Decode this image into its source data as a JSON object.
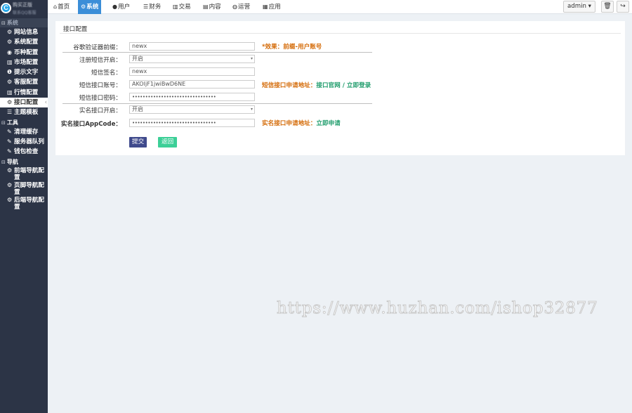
{
  "brand": {
    "logo": "C",
    "name": "购买正版",
    "sub": "联系QQ客服"
  },
  "sidebar": {
    "sections": [
      {
        "label": "系统",
        "items": [
          {
            "icon": "gear-icon",
            "glyph": "⚙",
            "label": "网站信息"
          },
          {
            "icon": "gear-icon",
            "glyph": "⚙",
            "label": "系统配置"
          },
          {
            "icon": "coin-icon",
            "glyph": "◉",
            "label": "币种配置"
          },
          {
            "icon": "bar-chart-icon",
            "glyph": "▥",
            "label": "市场配置"
          },
          {
            "icon": "info-icon",
            "glyph": "❶",
            "label": "提示文字"
          },
          {
            "icon": "gear-icon",
            "glyph": "⚙",
            "label": "客服配置"
          },
          {
            "icon": "bar-chart-icon",
            "glyph": "▥",
            "label": "行情配置"
          },
          {
            "icon": "gear-icon",
            "glyph": "⚙",
            "label": "接口配置",
            "active": true
          },
          {
            "icon": "list-icon",
            "glyph": "☰",
            "label": "主题模板"
          }
        ]
      },
      {
        "label": "工具",
        "items": [
          {
            "icon": "wrench-icon",
            "glyph": "✎",
            "label": "清理缓存"
          },
          {
            "icon": "wrench-icon",
            "glyph": "✎",
            "label": "服务器队列"
          },
          {
            "icon": "wrench-icon",
            "glyph": "✎",
            "label": "钱包检查"
          }
        ]
      },
      {
        "label": "导航",
        "items": [
          {
            "icon": "gear-icon",
            "glyph": "⚙",
            "label": "前端导航配置"
          },
          {
            "icon": "gear-icon",
            "glyph": "⚙",
            "label": "页脚导航配置"
          },
          {
            "icon": "gear-icon",
            "glyph": "⚙",
            "label": "后端导航配置"
          }
        ]
      }
    ]
  },
  "topbar": {
    "tabs": [
      {
        "icon": "home-icon",
        "glyph": "⌂",
        "label": "首页"
      },
      {
        "icon": "gear-icon",
        "glyph": "⚙",
        "label": "系统",
        "active": true
      },
      {
        "icon": "user-icon",
        "glyph": "●",
        "label": "用户"
      },
      {
        "icon": "list-icon",
        "glyph": "☰",
        "label": "财务"
      },
      {
        "icon": "bar-chart-icon",
        "glyph": "▥",
        "label": "交易"
      },
      {
        "icon": "document-icon",
        "glyph": "▤",
        "label": "内容"
      },
      {
        "icon": "globe-icon",
        "glyph": "◍",
        "label": "运营"
      },
      {
        "icon": "grid-icon",
        "glyph": "▦",
        "label": "应用"
      }
    ],
    "admin_label": "admin ▾",
    "trash_glyph": "🗑",
    "logout_glyph": "↪"
  },
  "panel": {
    "title": "接口配置",
    "rows": [
      {
        "label": "谷歌验证器前缀：",
        "value": "newx",
        "type": "text"
      },
      {
        "label": "注册短信开启：",
        "value": "开启",
        "type": "select"
      },
      {
        "label": "短信签名：",
        "value": "newx",
        "type": "text"
      },
      {
        "label": "短信接口账号：",
        "value": "AKOIjF1jwiBwD6NE",
        "type": "text"
      },
      {
        "label": "短信接口密码：",
        "value": "••••••••••••••••••••••••••••••••",
        "type": "password"
      },
      {
        "label": "实名接口开启：",
        "value": "开启",
        "type": "select"
      },
      {
        "label": "实名接口AppCode：",
        "value": "••••••••••••••••••••••••••••••••",
        "type": "password"
      }
    ],
    "hints": {
      "prefix": "*效果：前缀-用户账号",
      "sms_pre": "短信接口申请地址：",
      "sms_link1": "接口官网",
      "sms_sep": " / ",
      "sms_link2": "立即登录",
      "realname_pre": "实名接口申请地址：",
      "realname_link": "立即申请"
    },
    "submit_label": "提交",
    "back_label": "返回"
  },
  "colors": {
    "sidebar_bg": "#2c3446",
    "active_tab": "#3b8ed8",
    "submit": "#3f4a8c",
    "back": "#3ccf97",
    "hint_orange": "#d46b08",
    "hint_green": "#1e9c6b"
  },
  "watermark": "https://www.huzhan.com/ishop32877"
}
